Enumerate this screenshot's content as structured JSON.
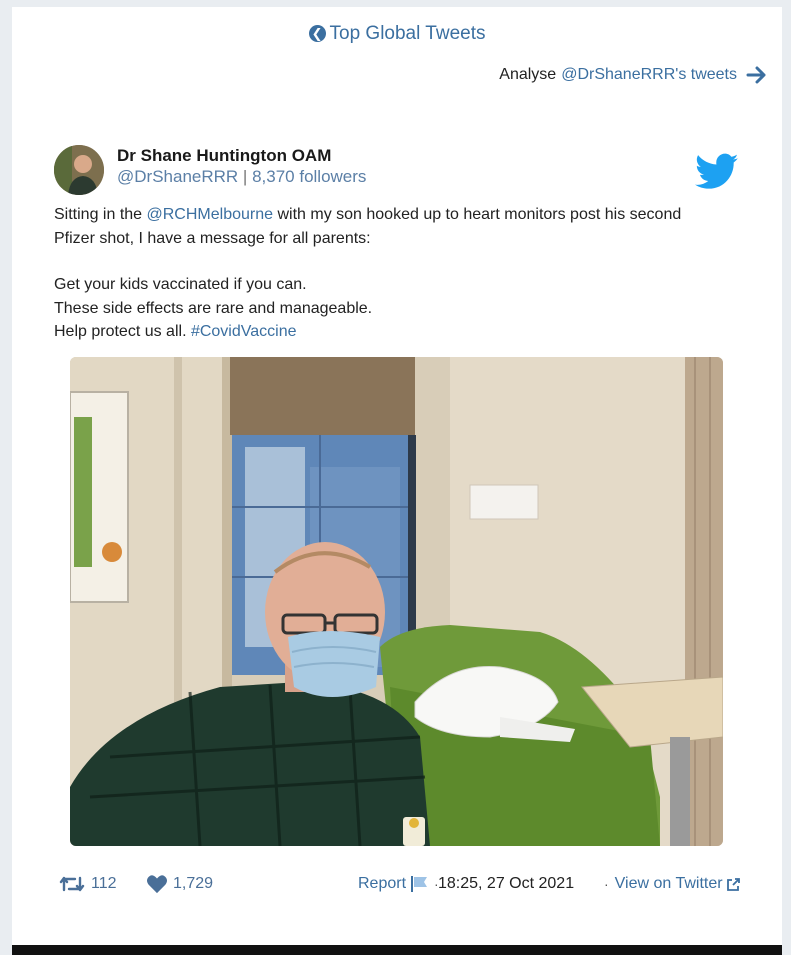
{
  "top_link": {
    "label": "Top Global Tweets"
  },
  "analyse": {
    "prefix": "Analyse",
    "handle": "@DrShaneRRR's tweets"
  },
  "tweet": {
    "author_name": "Dr Shane Huntington OAM",
    "handle": "@DrShaneRRR",
    "separator": "|",
    "followers": "8,370 followers",
    "text": {
      "line1_a": "Sitting in the ",
      "line1_mention": "@RCHMelbourne",
      "line1_b": " with my son hooked up to heart monitors post his second",
      "line2": "Pfizer shot, I have a message for all parents:",
      "line3": "Get your kids vaccinated if you can.",
      "line4": "These side effects are rare and manageable.",
      "line5_a": "Help protect us all. ",
      "line5_hashtag": "#CovidVaccine"
    }
  },
  "footer": {
    "retweets": "112",
    "likes": "1,729",
    "report_label": "Report",
    "timestamp": "18:25, 27 Oct 2021",
    "view_label": "View on Twitter"
  },
  "icons": {
    "back": "circle-arrow-left-icon",
    "forward": "arrow-right-icon",
    "brand": "twitter-bird-icon",
    "retweet": "retweet-icon",
    "like": "heart-icon",
    "flag": "flag-icon",
    "external": "external-link-icon"
  },
  "colors": {
    "link": "#3b6fa0",
    "twitter_blue": "#1da1f2",
    "page_bg": "#e9edf1"
  }
}
